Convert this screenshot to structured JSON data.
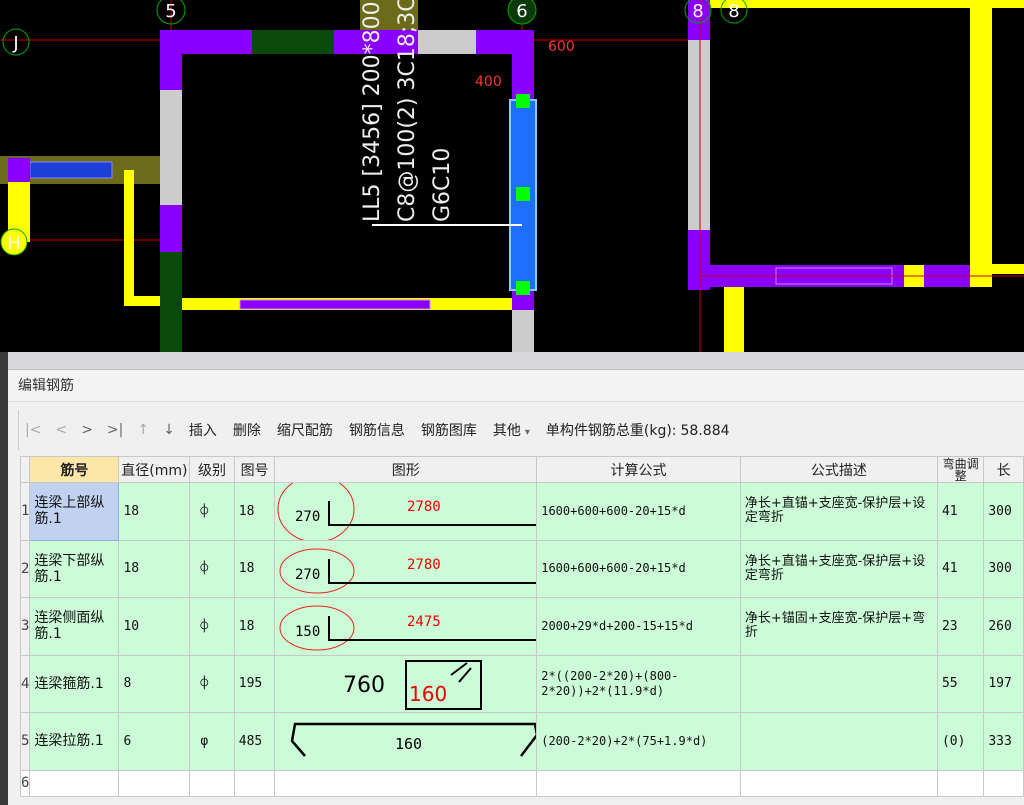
{
  "cad": {
    "axis_labels": [
      "5",
      "6",
      "8",
      "8",
      "J",
      "H"
    ],
    "dimensions": [
      "600",
      "400"
    ],
    "beam_annotation": [
      "LL5 [3456] 200*800",
      "C8@100(2) 3C18;3C",
      "G6C10"
    ]
  },
  "panel": {
    "title": "编辑钢筋",
    "toolbar": {
      "first": "|<",
      "prev": "<",
      "next": ">",
      "last": ">|",
      "up": "↑",
      "down": "↓",
      "insert": "插入",
      "delete": "删除",
      "scale": "缩尺配筋",
      "info": "钢筋信息",
      "library": "钢筋图库",
      "other": "其他",
      "other_arrow": "▾",
      "total_label": "单构件钢筋总重(kg):",
      "total_value": "58.884"
    },
    "columns": [
      "筋号",
      "直径(mm)",
      "级别",
      "图号",
      "图形",
      "计算公式",
      "公式描述",
      "弯曲调整",
      "长"
    ],
    "rows": [
      {
        "no": "1",
        "name": "连梁上部纵筋.1",
        "dia": "18",
        "grade": "⌽",
        "fig": "18",
        "shape": {
          "type": "L",
          "left": "270",
          "main": "2780"
        },
        "formula": "1600+600+600-20+15*d",
        "desc": "净长+直锚+支座宽-保护层+设定弯折",
        "bend": "41",
        "len": "300"
      },
      {
        "no": "2",
        "name": "连梁下部纵筋.1",
        "dia": "18",
        "grade": "⌽",
        "fig": "18",
        "shape": {
          "type": "L",
          "left": "270",
          "main": "2780"
        },
        "formula": "1600+600+600-20+15*d",
        "desc": "净长+直锚+支座宽-保护层+设定弯折",
        "bend": "41",
        "len": "300"
      },
      {
        "no": "3",
        "name": "连梁侧面纵筋.1",
        "dia": "10",
        "grade": "⌽",
        "fig": "18",
        "shape": {
          "type": "L",
          "left": "150",
          "main": "2475"
        },
        "formula": "2000+29*d+200-15+15*d",
        "desc": "净长+锚固+支座宽-保护层+弯折",
        "bend": "23",
        "len": "260"
      },
      {
        "no": "4",
        "name": "连梁箍筋.1",
        "dia": "8",
        "grade": "⌽",
        "fig": "195",
        "shape": {
          "type": "stirrup",
          "left": "760",
          "main": "160"
        },
        "formula": "2*((200-2*20)+(800-2*20))+2*(11.9*d)",
        "desc": "",
        "bend": "55",
        "len": "197"
      },
      {
        "no": "5",
        "name": "连梁拉筋.1",
        "dia": "6",
        "grade": "φ",
        "fig": "485",
        "shape": {
          "type": "tie",
          "main": "160"
        },
        "formula": "(200-2*20)+2*(75+1.9*d)",
        "desc": "",
        "bend": "(0)",
        "len": "333"
      },
      {
        "no": "6"
      }
    ]
  }
}
